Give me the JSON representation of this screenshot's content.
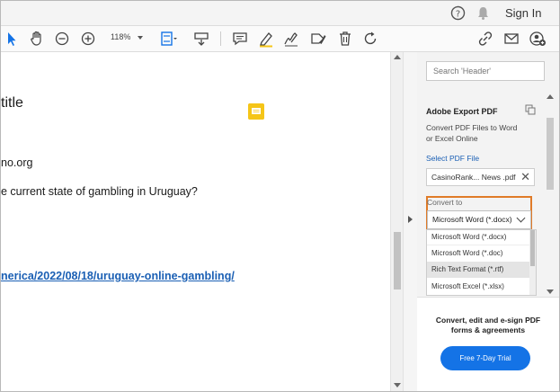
{
  "topbar": {
    "sign_in": "Sign In"
  },
  "toolbar": {
    "zoom": "118%"
  },
  "document": {
    "lines": [
      "title",
      "no.org",
      "e current state of gambling in Uruguay?",
      "nerica/2022/08/18/uruguay-online-gambling/"
    ]
  },
  "panel": {
    "search_placeholder": "Search 'Header'",
    "title": "Adobe Export PDF",
    "description_line1": "Convert PDF Files to Word",
    "description_line2": "or Excel Online",
    "select_pdf_link": "Select PDF File",
    "file_name": "CasinoRank... News .pdf",
    "convert_to_label": "Convert to",
    "selected_format": "Microsoft Word (*.docx)",
    "options": [
      "Microsoft Word (*.docx)",
      "Microsoft Word (*.doc)",
      "Rich Text Format (*.rtf)",
      "Microsoft Excel (*.xlsx)"
    ],
    "promo_line1": "Convert, edit and e-sign PDF",
    "promo_line2": "forms & agreements",
    "trial_button": "Free 7-Day Trial"
  },
  "colors": {
    "accent": "#1473e6",
    "highlight": "#e07b28",
    "link": "#1a5fb4",
    "note": "#f5c518"
  }
}
